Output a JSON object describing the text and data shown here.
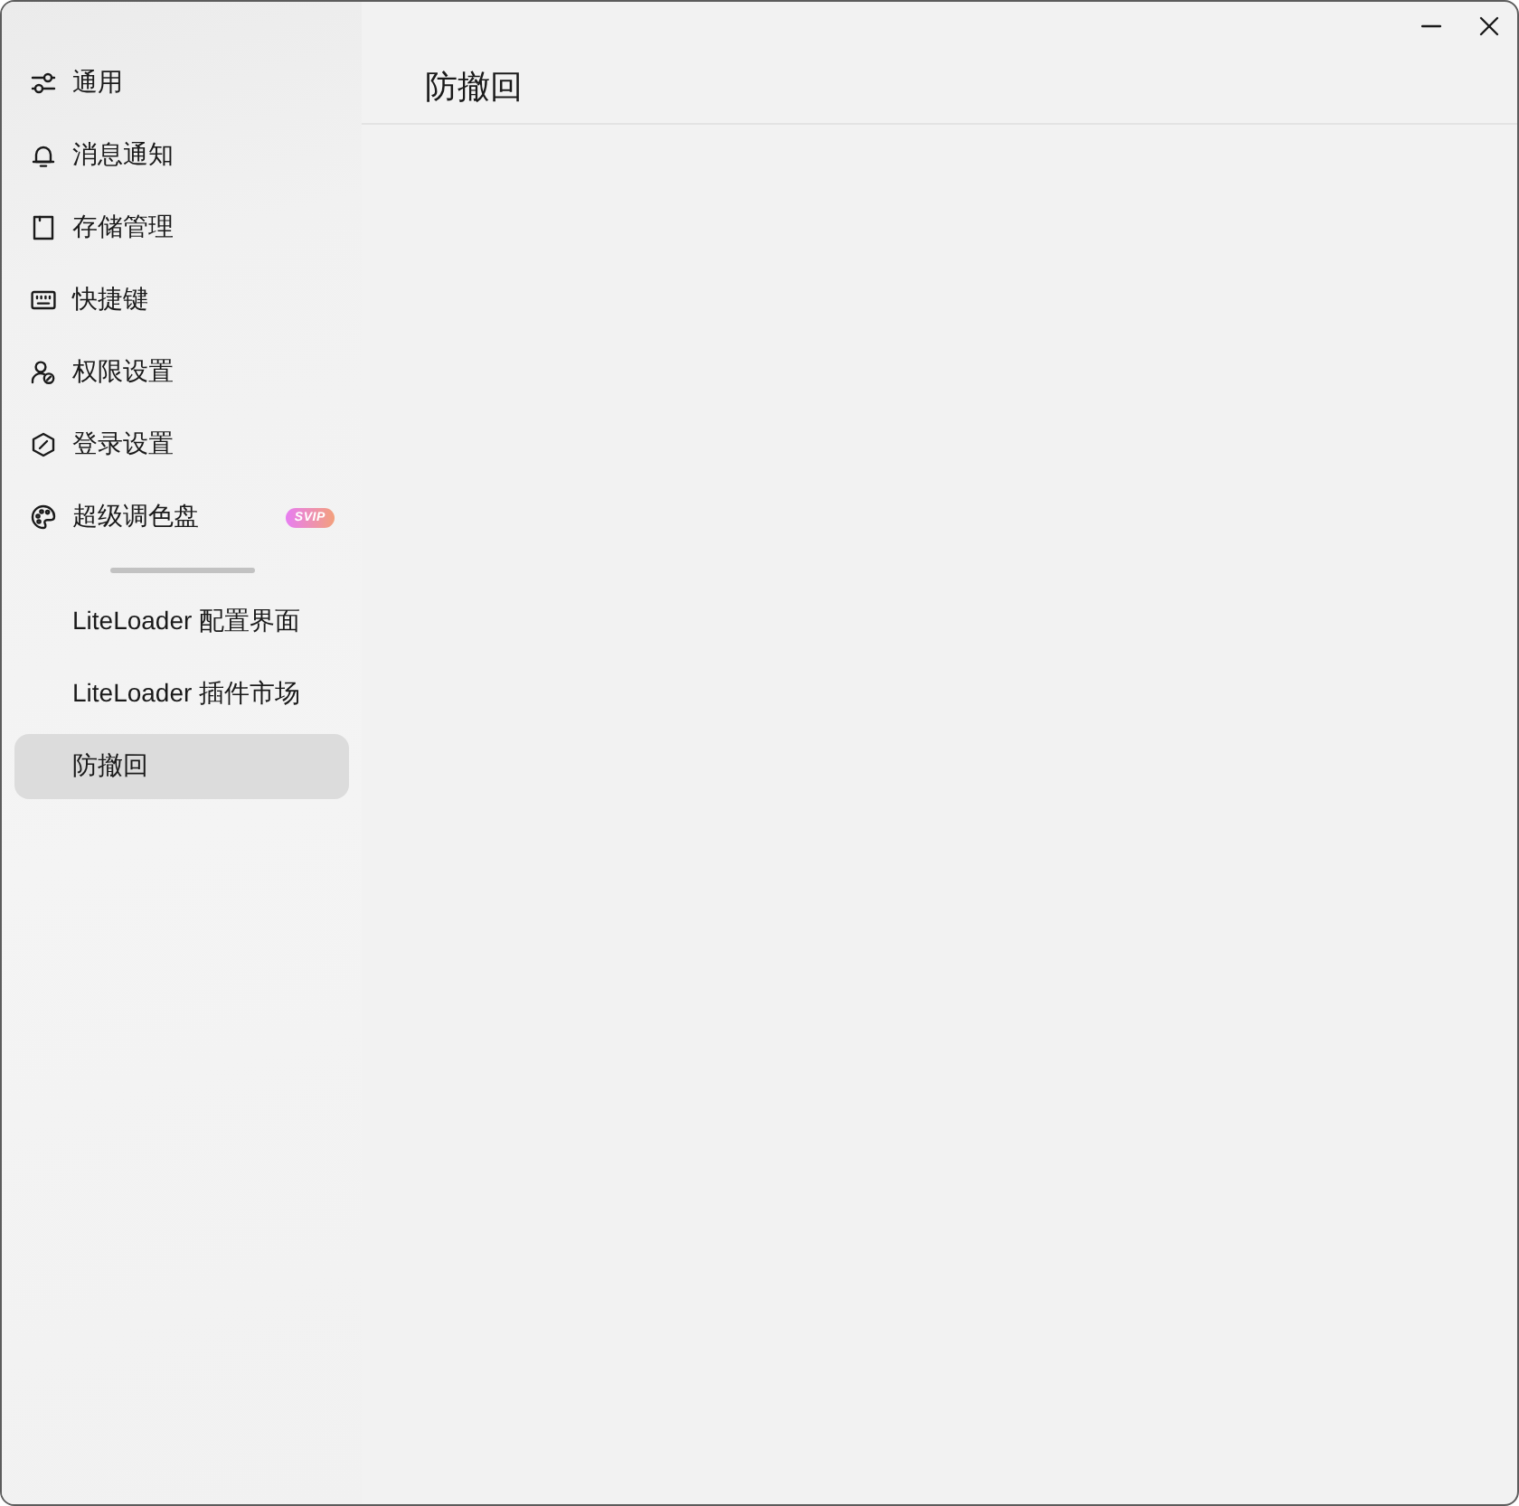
{
  "sidebar": {
    "items": [
      {
        "label": "通用",
        "selected": false
      },
      {
        "label": "消息通知",
        "selected": false
      },
      {
        "label": "存储管理",
        "selected": false
      },
      {
        "label": "快捷键",
        "selected": false
      },
      {
        "label": "权限设置",
        "selected": false
      },
      {
        "label": "登录设置",
        "selected": false
      },
      {
        "label": "超级调色盘",
        "selected": false,
        "badge": "SVIP"
      }
    ],
    "plugins": [
      {
        "label": "LiteLoader 配置界面",
        "selected": false
      },
      {
        "label": "LiteLoader 插件市场",
        "selected": false
      },
      {
        "label": "防撤回",
        "selected": true
      }
    ]
  },
  "page": {
    "title": "防撤回"
  }
}
